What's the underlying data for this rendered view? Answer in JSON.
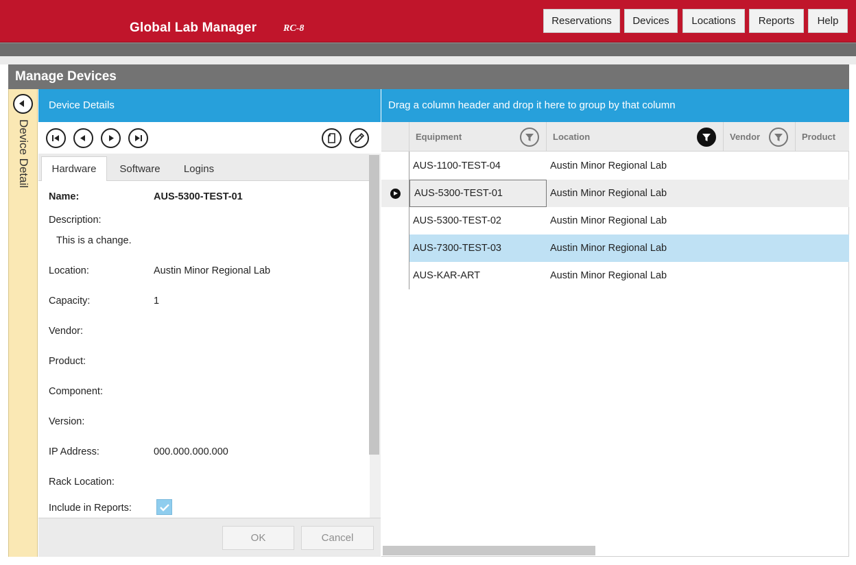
{
  "app": {
    "title": "Global Lab Manager",
    "version": "RC-8"
  },
  "nav": {
    "items": [
      "Reservations",
      "Devices",
      "Locations",
      "Reports",
      "Help"
    ]
  },
  "page": {
    "title": "Manage Devices"
  },
  "side_tab": {
    "label": "Device Detail"
  },
  "details": {
    "header": "Device Details",
    "tabs": [
      "Hardware",
      "Software",
      "Logins"
    ],
    "active_tab": "Hardware",
    "fields": {
      "name_label": "Name:",
      "name_value": "AUS-5300-TEST-01",
      "description_label": "Description:",
      "description_value": "This is a change.",
      "location_label": "Location:",
      "location_value": "Austin Minor Regional Lab",
      "capacity_label": "Capacity:",
      "capacity_value": "1",
      "vendor_label": "Vendor:",
      "vendor_value": "",
      "product_label": "Product:",
      "product_value": "",
      "component_label": "Component:",
      "component_value": "",
      "version_label": "Version:",
      "version_value": "",
      "ip_label": "IP Address:",
      "ip_value": "000.000.000.000",
      "rack_label": "Rack Location:",
      "rack_value": "",
      "include_label": "Include in Reports:",
      "include_checked": true
    },
    "buttons": {
      "ok": "OK",
      "cancel": "Cancel"
    }
  },
  "grid": {
    "group_hint": "Drag a column header and drop it here to group by that column",
    "columns": [
      "Equipment",
      "Location",
      "Vendor",
      "Product"
    ],
    "filter_active_column": "Location",
    "rows": [
      {
        "equipment": "AUS-1100-TEST-04",
        "location": "Austin Minor Regional Lab"
      },
      {
        "equipment": "AUS-5300-TEST-01",
        "location": "Austin Minor Regional Lab"
      },
      {
        "equipment": "AUS-5300-TEST-02",
        "location": "Austin Minor Regional Lab"
      },
      {
        "equipment": "AUS-7300-TEST-03",
        "location": "Austin Minor Regional Lab"
      },
      {
        "equipment": "AUS-KAR-ART",
        "location": "Austin Minor Regional Lab"
      }
    ],
    "current_row_index": 1,
    "selected_row_index": 3
  },
  "colors": {
    "brand_red": "#c0152b",
    "accent_blue": "#27a0db",
    "panel_gray": "#737373",
    "side_tab_yellow": "#fae8b4",
    "selected_row": "#bfe1f4"
  }
}
